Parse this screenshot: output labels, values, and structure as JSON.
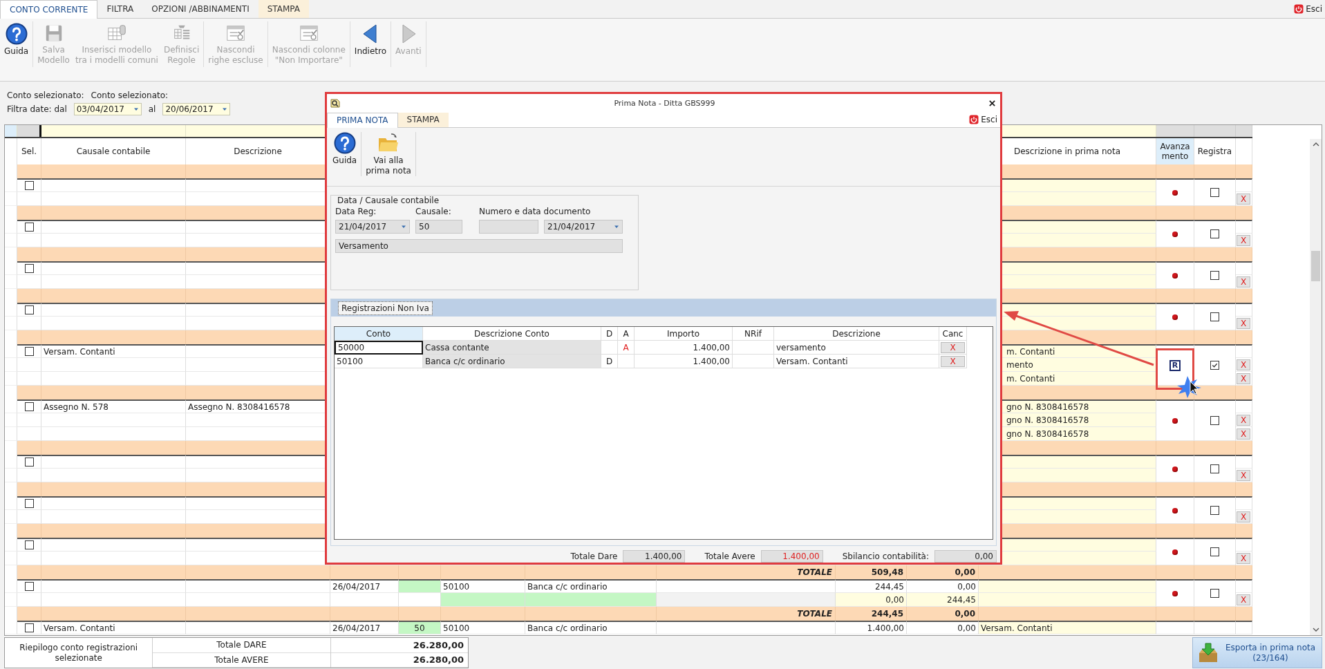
{
  "tabs": [
    {
      "label": "CONTO CORRENTE",
      "selected": true,
      "kind": "normal"
    },
    {
      "label": "FILTRA",
      "selected": false,
      "kind": "normal"
    },
    {
      "label": "OPZIONI /ABBINAMENTI",
      "selected": false,
      "kind": "normal"
    },
    {
      "label": "STAMPA",
      "selected": false,
      "kind": "contextual"
    }
  ],
  "exit_label": "Esci",
  "ribbon": [
    [
      {
        "label": "Guida",
        "kind": "help",
        "disabled": false
      }
    ],
    [
      {
        "label": "Salva\nModello",
        "kind": "save",
        "disabled": true
      },
      {
        "label": "Inserisci modello\ntra i modelli comuni",
        "kind": "table",
        "disabled": true
      },
      {
        "label": "Definisci\nRegole",
        "kind": "rules",
        "disabled": true
      }
    ],
    [
      {
        "label": "Nascondi\nrighe escluse",
        "kind": "hide",
        "disabled": true
      }
    ],
    [
      {
        "label": "Nascondi colonne\n\"Non Importare\"",
        "kind": "hide",
        "disabled": true
      }
    ],
    [
      {
        "label": "Indietro",
        "kind": "back",
        "disabled": false
      }
    ],
    [
      {
        "label": "Avanti",
        "kind": "forward",
        "disabled": true
      }
    ]
  ],
  "filter": {
    "account_labels": [
      "Conto selezionato:",
      "Conto selezionato:"
    ],
    "from_label": "Filtra date: dal",
    "from": "03/04/2017",
    "to_label": "al",
    "to": "20/06/2017"
  },
  "grid": {
    "headers": {
      "sel": "Sel.",
      "causale_contabile": "Causale contabile",
      "descrizione": "Descrizione",
      "descrizione_in_prima_nota": "Descrizione in prima nota",
      "avanzamento": "Avanza\nmento",
      "registra": "Registra"
    },
    "groups": [
      {
        "checked": false,
        "advanced": false,
        "registered": false,
        "rows": [
          {},
          {
            "delete_label": "X"
          }
        ]
      },
      {
        "checked": false,
        "advanced": false,
        "registered": false,
        "rows": [
          {},
          {
            "delete_label": "X"
          }
        ]
      },
      {
        "checked": false,
        "advanced": false,
        "registered": false,
        "rows": [
          {},
          {
            "delete_label": "X"
          }
        ]
      },
      {
        "checked": false,
        "advanced": false,
        "registered": false,
        "rows": [
          {},
          {
            "delete_label": "X"
          }
        ]
      },
      {
        "checked": false,
        "advanced": true,
        "progress_label": "R",
        "registered": true,
        "rows": [
          {
            "causale_contabile": "Versam. Contanti",
            "descrizione_in_prima_nota": "m. Contanti"
          },
          {
            "descrizione_in_prima_nota": "mento",
            "delete_label": "X"
          },
          {
            "descrizione_in_prima_nota": "m. Contanti",
            "delete_label": "X"
          }
        ]
      },
      {
        "checked": false,
        "advanced": false,
        "registered": false,
        "rows": [
          {
            "causale_contabile": "Assegno N. 578",
            "descrizione": "Assegno N. 8308416578",
            "descrizione_in_prima_nota": "gno N. 8308416578"
          },
          {
            "descrizione_in_prima_nota": "gno N. 8308416578",
            "delete_label": "X"
          },
          {
            "descrizione_in_prima_nota": "gno N. 8308416578",
            "delete_label": "X"
          }
        ]
      },
      {
        "checked": false,
        "advanced": false,
        "registered": false,
        "rows": [
          {},
          {
            "delete_label": "X"
          }
        ]
      },
      {
        "checked": false,
        "advanced": false,
        "registered": false,
        "rows": [
          {},
          {
            "delete_label": "X"
          }
        ]
      },
      {
        "checked": false,
        "advanced": false,
        "registered": false,
        "rows": [
          {},
          {
            "delete_label": "X"
          }
        ]
      },
      {
        "total": {
          "label": "TOTALE",
          "dare": "509,48",
          "avere": "0,00"
        },
        "checked": false,
        "advanced": false,
        "registered": false,
        "rows": [
          {
            "column_4": "26/04/2017",
            "column_6": "50100",
            "column_7": "Banca c/c ordinario",
            "column_9": "244,45",
            "column_10": "0,00",
            "code_highlighted": true
          },
          {
            "column_9": "0,00",
            "column_10": "244,45",
            "account_highlighted": true,
            "balancing": true,
            "delete_label": "X"
          }
        ]
      },
      {
        "total": {
          "label": "TOTALE",
          "dare": "244,45",
          "avere": "0,00"
        },
        "checked": false,
        "rows": [
          {
            "causale_contabile": "Versam. Contanti",
            "column_4": "26/04/2017",
            "column_5": "50",
            "column_6": "50100",
            "column_7": "Banca c/c ordinario",
            "column_9": "1.400,00",
            "column_10": "0,00",
            "descrizione_in_prima_nota": "Versam. Contanti",
            "code_highlighted": true
          }
        ]
      }
    ]
  },
  "summary": {
    "title": "Riepilogo conto registrazioni selezionate",
    "lines": [
      {
        "label": "Totale DARE",
        "value": "26.280,00"
      },
      {
        "label": "Totale AVERE",
        "value": "26.280,00"
      }
    ]
  },
  "export_button": {
    "label": "Esporta in prima nota\n(23/164)"
  },
  "dialog": {
    "title": "Prima Nota - Ditta GBS999",
    "tabs": [
      {
        "label": "PRIMA NOTA",
        "selected": true,
        "kind": "normal"
      },
      {
        "label": "STAMPA",
        "selected": false,
        "kind": "contextual"
      }
    ],
    "exit_label": "Esci",
    "ribbon": [
      {
        "label": "Guida",
        "kind": "help"
      },
      {
        "label": "Vai alla\nprima nota",
        "kind": "folder"
      }
    ],
    "group_title": "Data / Causale contabile",
    "date_reg": {
      "label": "Data Reg:",
      "value": "21/04/2017"
    },
    "causale": {
      "label": "Causale:",
      "value": "50"
    },
    "document": {
      "label": "Numero e data documento",
      "date": "21/04/2017"
    },
    "description": "Versamento",
    "subtab": {
      "label": "Registrazioni Non Iva"
    },
    "table": {
      "columns": [
        "Conto",
        "Descrizione Conto",
        "D",
        "A",
        "Importo",
        "NRif",
        "Descrizione",
        "Canc"
      ],
      "rows": [
        {
          "conto": "50000",
          "descrizione_conto": "Cassa contante",
          "a": "A",
          "importo": "1.400,00",
          "descrizione": "versamento",
          "delete_label": "X",
          "focused": true
        },
        {
          "conto": "50100",
          "descrizione_conto": "Banca c/c ordinario",
          "d": "D",
          "importo": "1.400,00",
          "descrizione": "Versam. Contanti",
          "delete_label": "X",
          "focused": false
        }
      ]
    },
    "totals": [
      {
        "label": "Totale Dare",
        "value": "1.400,00",
        "kind": "normal"
      },
      {
        "label": "Totale Avere",
        "value": "1.400,00",
        "kind": "alert"
      },
      {
        "label": "Sbilancio contabilità:",
        "value": "0,00",
        "kind": "normal"
      }
    ]
  }
}
